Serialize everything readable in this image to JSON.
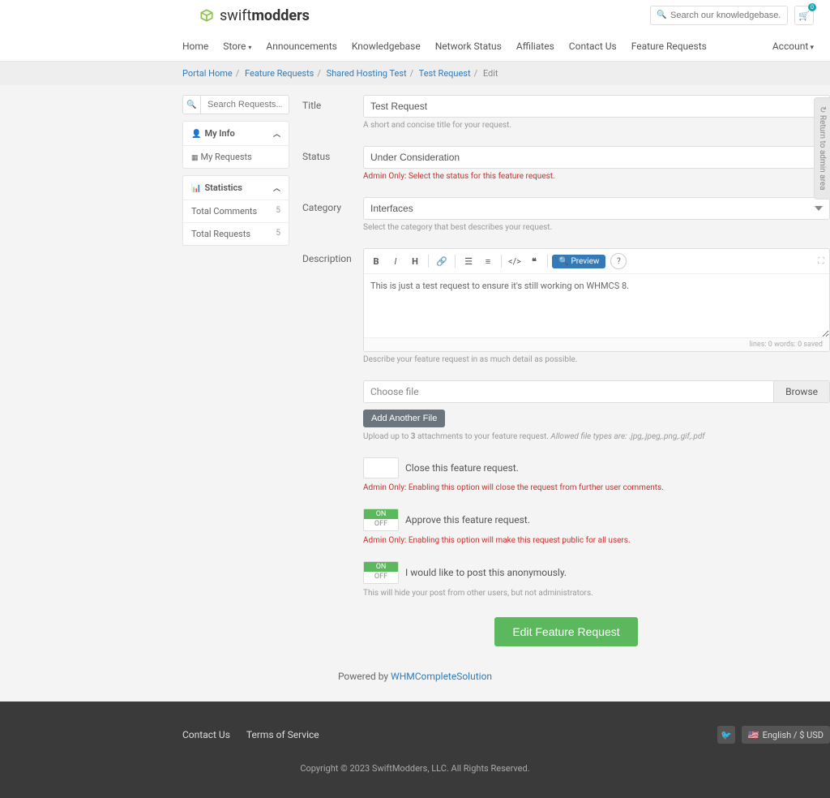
{
  "logo": {
    "light": "swift",
    "bold": "modders"
  },
  "search_placeholder": "Search our knowledgebase...",
  "cart_count": "0",
  "nav": [
    "Home",
    "Store",
    "Announcements",
    "Knowledgebase",
    "Network Status",
    "Affiliates",
    "Contact Us",
    "Feature Requests"
  ],
  "account_label": "Account",
  "breadcrumb": {
    "items": [
      "Portal Home",
      "Feature Requests",
      "Shared Hosting Test",
      "Test Request"
    ],
    "current": "Edit"
  },
  "sidebar": {
    "search_placeholder": "Search Requests...",
    "myinfo_title": "My Info",
    "myinfo_item": "My Requests",
    "stats_title": "Statistics",
    "stats": [
      {
        "label": "Total Comments",
        "count": "5"
      },
      {
        "label": "Total Requests",
        "count": "5"
      }
    ]
  },
  "form": {
    "title_label": "Title",
    "title_value": "Test Request",
    "title_help": "A short and concise title for your request.",
    "status_label": "Status",
    "status_value": "Under Consideration",
    "status_admin": "Admin Only:",
    "status_admin_text": " Select the status for this feature request.",
    "category_label": "Category",
    "category_value": "Interfaces",
    "category_help": "Select the category that best describes your request.",
    "desc_label": "Description",
    "desc_value": "This is just a test request to ensure it's still working on WHMCS 8.",
    "preview_label": "Preview",
    "editor_status": "lines: 0   words: 0   saved",
    "desc_help": "Describe your feature request in as much detail as possible.",
    "file_placeholder": "Choose file",
    "browse_label": "Browse",
    "add_file_label": "Add Another File",
    "upload_note_1": "Upload up to ",
    "upload_note_2": "3",
    "upload_note_3": " attachments to your feature request. ",
    "upload_note_4": "Allowed file types are: .jpg,.jpeg,.png,.gif,.pdf",
    "close_label": "Close this feature request.",
    "close_admin": "Admin Only:",
    "close_admin_text": " Enabling this option will close the request from further user comments.",
    "approve_label": "Approve this feature request.",
    "approve_admin": "Admin Only:",
    "approve_admin_text": " Enabling this option will make this request public for all users.",
    "anon_label": "I would like to post this anonymously.",
    "anon_help": "This will hide your post from other users, but not administrators.",
    "toggle_on": "ON",
    "toggle_off": "OFF",
    "submit_label": "Edit Feature Request"
  },
  "powered_prefix": "Powered by ",
  "powered_link": "WHMCompleteSolution",
  "footer": {
    "links": [
      "Contact Us",
      "Terms of Service"
    ],
    "lang": "English / $ USD",
    "copyright": "Copyright © 2023 SwiftModders, LLC. All Rights Reserved."
  },
  "admin_tab": "↻ Return to admin area"
}
